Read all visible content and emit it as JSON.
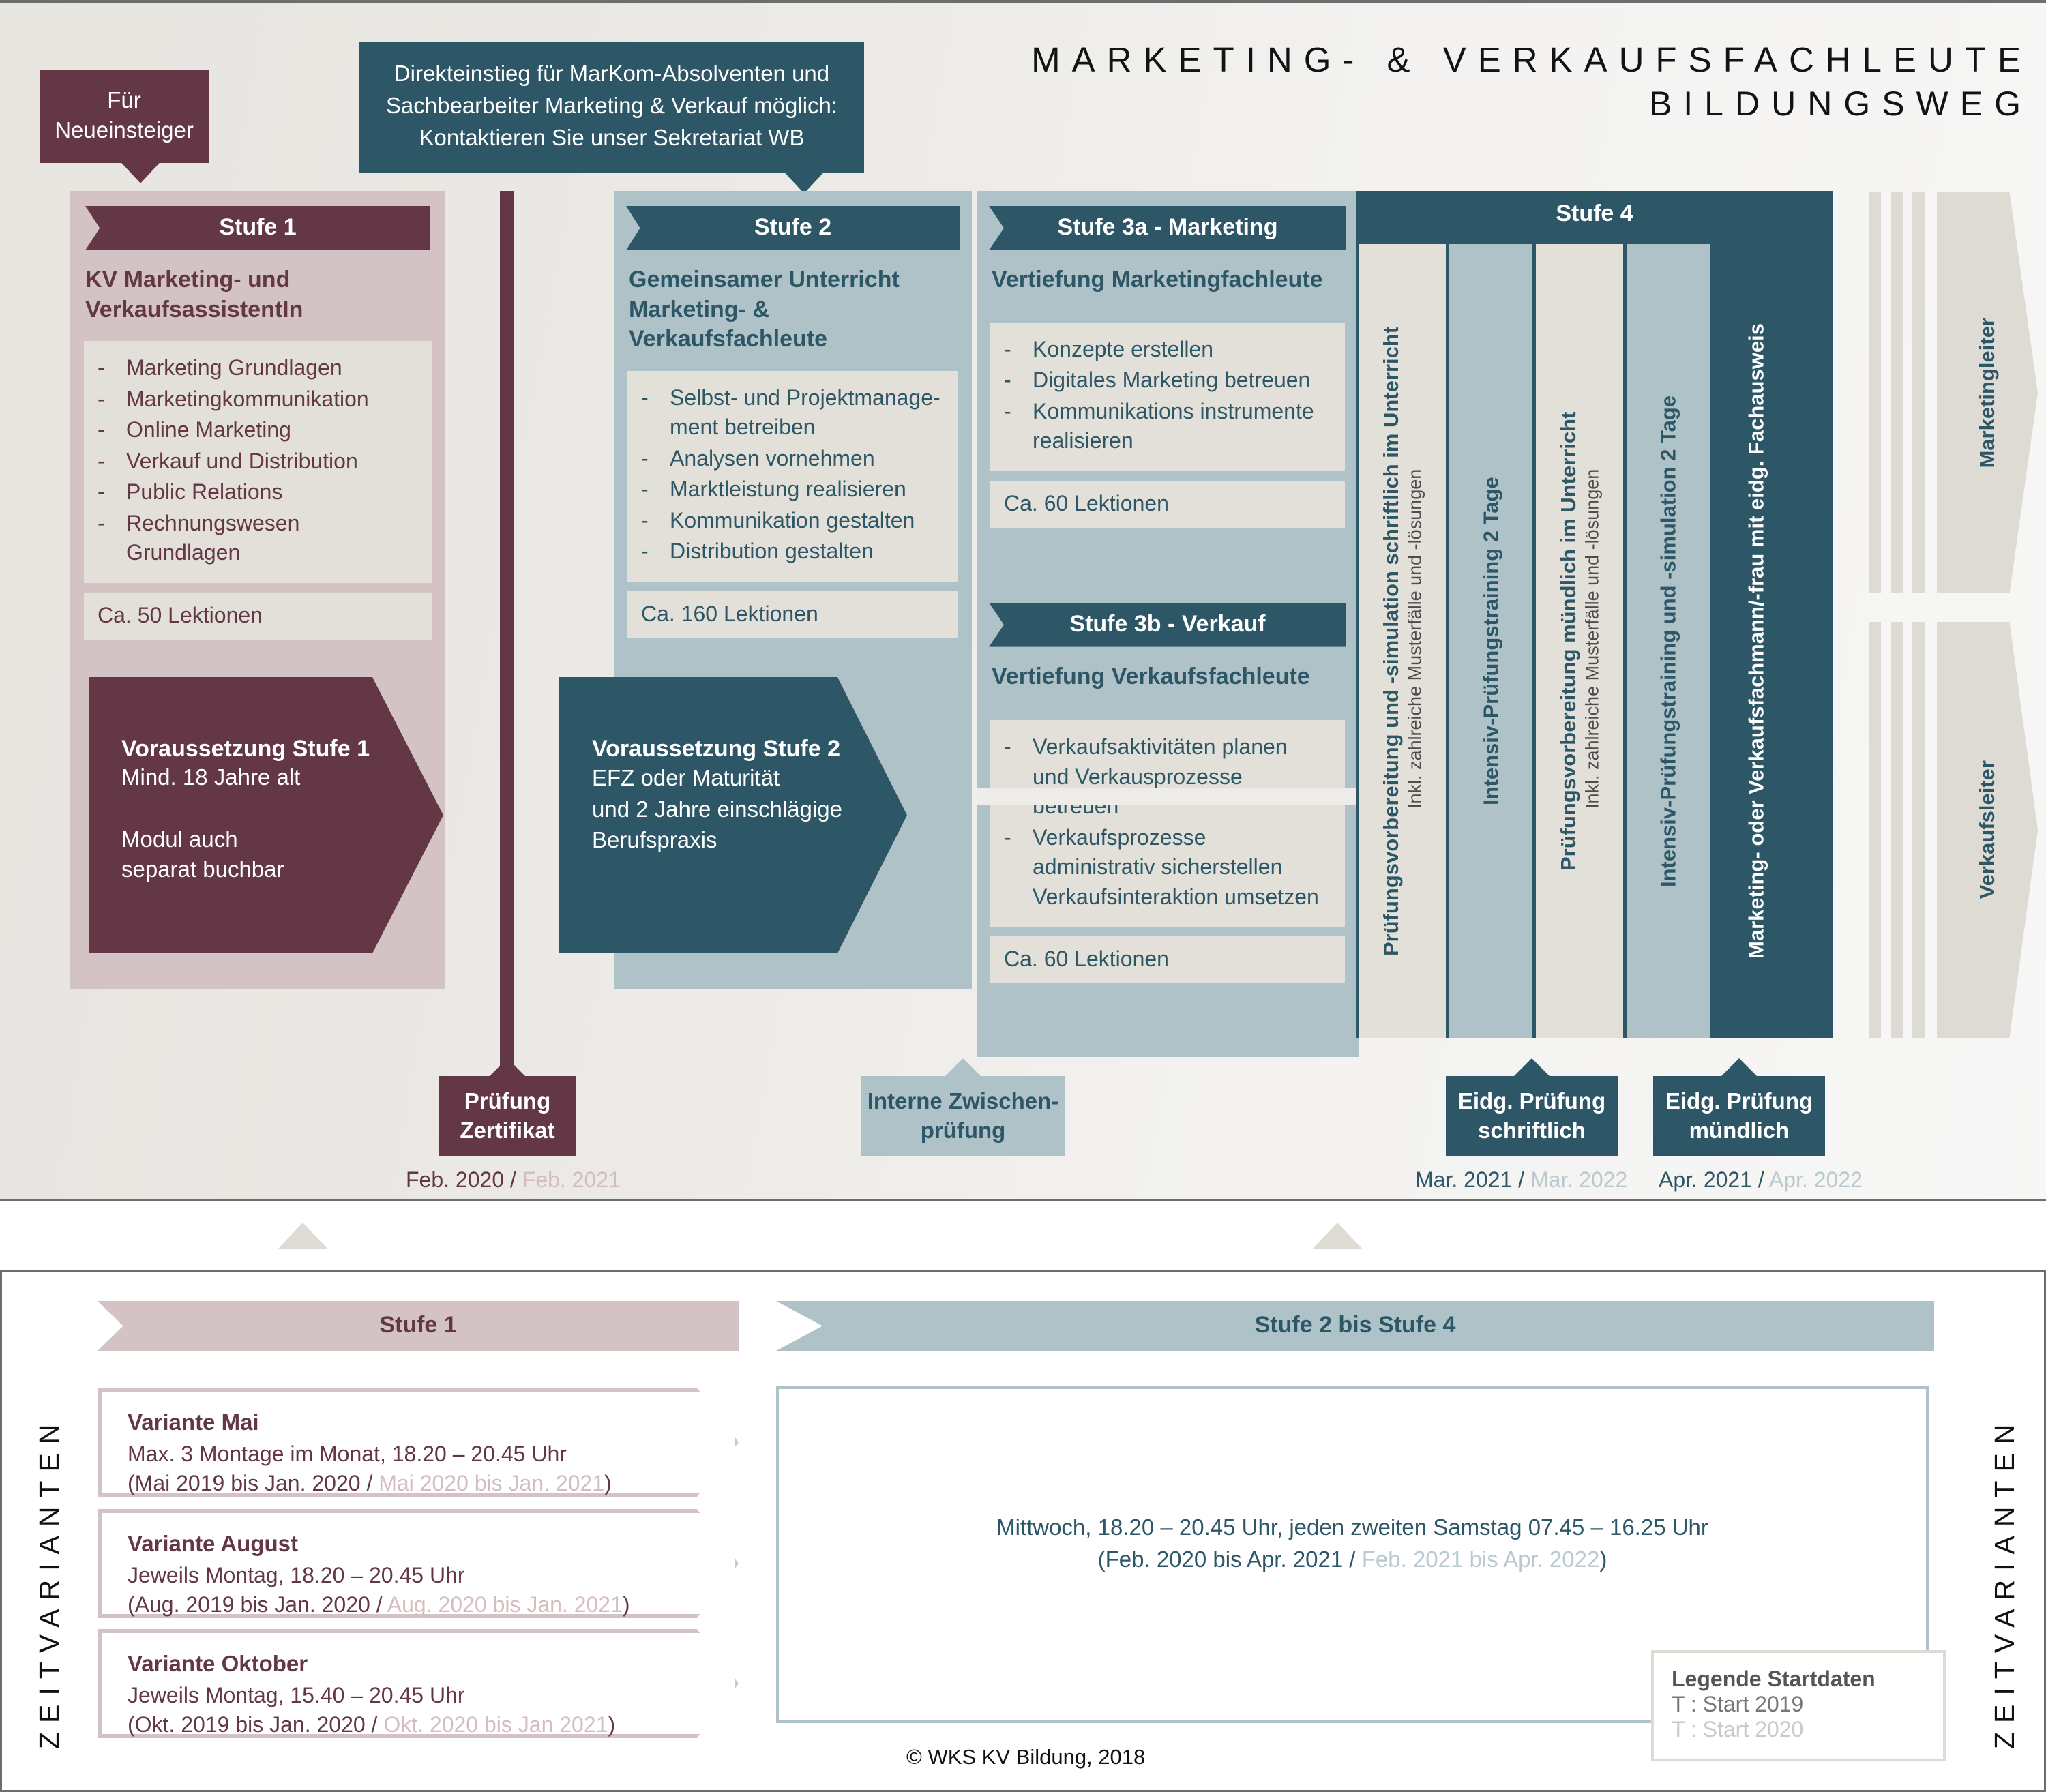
{
  "header": {
    "line1": "MARKETING- & VERKAUFSFACHLEUTE",
    "line2": "BILDUNGSWEG"
  },
  "callouts": {
    "neueinsteiger": "Für\nNeueinsteiger",
    "direkteinstieg": "Direkteinstieg für MarKom-Absolventen und\nSachbearbeiter Marketing & Verkauf möglich:\nKontaktieren Sie unser Sekretariat WB"
  },
  "stage1": {
    "ribbon": "Stufe 1",
    "subtitle": "KV Marketing- und\nVerkaufsassistentIn",
    "items": [
      "Marketing Grundlagen",
      "Marketingkommunikation",
      "Online Marketing",
      "Verkauf und Distribution",
      "Public Relations",
      "Rechnungswesen Grundlagen"
    ],
    "lektionen": "Ca. 50 Lektionen",
    "voraussetzung": {
      "title": "Voraussetzung Stufe 1",
      "line1": "Mind. 18 Jahre alt",
      "line2": "Modul auch",
      "line3": "separat buchbar"
    }
  },
  "stage2": {
    "ribbon": "Stufe 2",
    "subtitle": "Gemeinsamer Unterricht\nMarketing- & Verkaufsfachleute",
    "items": [
      "Selbst- und Projektmanage-\nment betreiben",
      "Analysen vornehmen",
      "Marktleistung realisieren",
      "Kommunikation gestalten",
      "Distribution gestalten"
    ],
    "lektionen": "Ca. 160 Lektionen",
    "voraussetzung": {
      "title": "Voraussetzung Stufe 2",
      "line1": "EFZ oder Maturität",
      "line2": "und 2 Jahre einschlägige",
      "line3": "Berufspraxis"
    }
  },
  "stage3a": {
    "ribbon": "Stufe 3a - Marketing",
    "subtitle": "Vertiefung Marketingfachleute",
    "items": [
      "Konzepte erstellen",
      "Digitales Marketing betreuen",
      "Kommunikations instrumente\nrealisieren"
    ],
    "lektionen": "Ca. 60 Lektionen"
  },
  "stage3b": {
    "ribbon": "Stufe 3b - Verkauf",
    "subtitle": "Vertiefung Verkaufsfachleute",
    "items": [
      "Verkaufsaktivitäten planen\nund Verkausprozesse\nbetreuen",
      "Verkaufsprozesse\nadministrativ sicherstellen\nVerkaufsinteraktion umsetzen"
    ],
    "lektionen": "Ca. 60 Lektionen"
  },
  "stage4": {
    "ribbon": "Stufe 4",
    "columns": [
      {
        "main": "Prüfungsvorbereitung und -simulation schriftlich im Unterricht",
        "sub": "Inkl. zahlreiche Musterfälle und -lösungen",
        "style": "beige"
      },
      {
        "main": "Intensiv-Prüfungstraining 2 Tage",
        "sub": "",
        "style": "blue"
      },
      {
        "main": "Prüfungsvorbereitung mündlich im Unterricht",
        "sub": "Inkl. zahlreiche Musterfälle und -lösungen",
        "style": "beige"
      },
      {
        "main": "Intensiv-Prüfungstraining und -simulation 2 Tage",
        "sub": "",
        "style": "blue"
      },
      {
        "main": "Marketing- oder Verkaufsfachmann/-frau mit eidg. Fachausweis",
        "sub": "",
        "style": "dark"
      }
    ]
  },
  "careers": [
    {
      "label": "Marketingleiter"
    },
    {
      "label": "Verkaufsleiter"
    }
  ],
  "exams": [
    {
      "label": "Prüfung\nZertifikat",
      "color": "rose",
      "date_current": "Feb. 2020",
      "date_sep": " / ",
      "date_next": "Feb. 2021"
    },
    {
      "label": "Interne Zwischen-\nprüfung",
      "color": "lightblue",
      "date_current": "",
      "date_sep": "",
      "date_next": ""
    },
    {
      "label": "Eidg. Prüfung\nschriftlich",
      "color": "teal",
      "date_current": "Mar. 2021",
      "date_sep": " / ",
      "date_next": "Mar. 2022"
    },
    {
      "label": "Eidg. Prüfung\nmündlich",
      "color": "teal",
      "date_current": "Apr. 2021",
      "date_sep": " / ",
      "date_next": "Apr. 2022"
    }
  ],
  "bottom": {
    "side_label_left": "ZEITVARIANTEN",
    "side_label_right": "ZEITVARIANTEN",
    "bar_stufe1": "Stufe 1",
    "bar_stufe24": "Stufe 2 bis Stufe 4",
    "variants": [
      {
        "title": "Variante Mai",
        "line1": "Max. 3 Montage im Monat, 18.20 – 20.45 Uhr",
        "line2_open": "(Mai 2019 bis Jan. 2020",
        "line2_sep": " / ",
        "line2_dim": "Mai 2020 bis Jan. 2021",
        "line2_close": ")"
      },
      {
        "title": "Variante August",
        "line1": "Jeweils Montag, 18.20 – 20.45 Uhr",
        "line2_open": "(Aug. 2019 bis Jan. 2020",
        "line2_sep": " / ",
        "line2_dim": "Aug. 2020 bis Jan. 2021",
        "line2_close": ")"
      },
      {
        "title": "Variante Oktober",
        "line1": "Jeweils Montag, 15.40 – 20.45 Uhr",
        "line2_open": "(Okt. 2019 bis Jan. 2020",
        "line2_sep": " / ",
        "line2_dim": "Okt. 2020 bis Jan 2021",
        "line2_close": ")"
      }
    ],
    "stufe24_line1": "Mittwoch, 18.20 – 20.45 Uhr, jeden zweiten Samstag 07.45 – 16.25 Uhr",
    "stufe24_line2_open": "(Feb. 2020 bis Apr. 2021",
    "stufe24_line2_sep": " / ",
    "stufe24_line2_dim": "Feb. 2021 bis Apr. 2022",
    "stufe24_line2_close": ")",
    "legende": {
      "title": "Legende Startdaten",
      "line1": "T : Start 2019",
      "line2": "T : Start 2020"
    },
    "copyright": "© WKS KV Bildung, 2018"
  },
  "colors": {
    "rose_dark": "#633745",
    "rose_light": "#d4c3c4",
    "teal_dark": "#2d5767",
    "teal_light": "#aec2c8",
    "beige": "#e2e0d9",
    "grey": "#dedbd4"
  }
}
